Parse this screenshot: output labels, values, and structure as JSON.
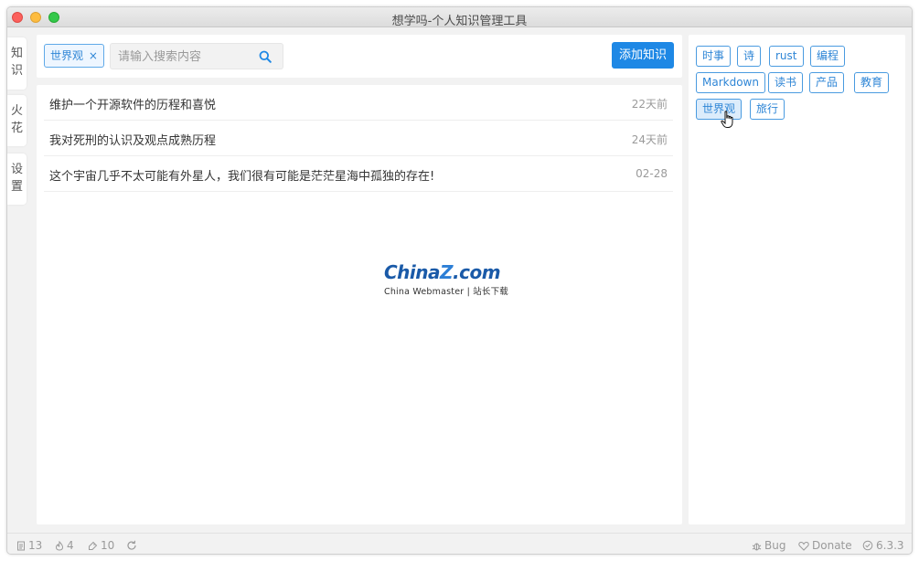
{
  "window": {
    "title": "想学吗-个人知识管理工具"
  },
  "sidebar": {
    "tabs": [
      {
        "label": [
          "知",
          "识"
        ]
      },
      {
        "label": [
          "火",
          "花"
        ]
      },
      {
        "label": [
          "设",
          "置"
        ]
      }
    ]
  },
  "toolbar": {
    "filter_chip": "世界观",
    "chip_close": "×",
    "search_placeholder": "请输入搜索内容",
    "add_button": "添加知识"
  },
  "list": {
    "items": [
      {
        "title": "维护一个开源软件的历程和喜悦",
        "time": "22天前"
      },
      {
        "title": "我对死刑的认识及观点成熟历程",
        "time": "24天前"
      },
      {
        "title": "这个宇宙几乎不太可能有外星人，我们很有可能是茫茫星海中孤独的存在!",
        "time": "02-28"
      }
    ]
  },
  "watermark": {
    "logo_a": "China",
    "logo_z": "Z",
    "logo_b": ".com",
    "sub": "China Webmaster | 站长下载"
  },
  "tags": [
    {
      "label": "时事"
    },
    {
      "label": "诗"
    },
    {
      "label": "rust"
    },
    {
      "label": "编程"
    },
    {
      "label": "Markdown"
    },
    {
      "label": "读书"
    },
    {
      "label": "产品"
    },
    {
      "label": "教育"
    },
    {
      "label": "世界观",
      "active": true
    },
    {
      "label": "旅行"
    }
  ],
  "statusbar": {
    "knowledge_count": "13",
    "spark_count": "4",
    "tag_count": "10",
    "bug": "Bug",
    "donate": "Donate",
    "version": "6.3.3"
  },
  "colors": {
    "accent": "#1e88e5",
    "tag_border": "#4a9be0"
  }
}
